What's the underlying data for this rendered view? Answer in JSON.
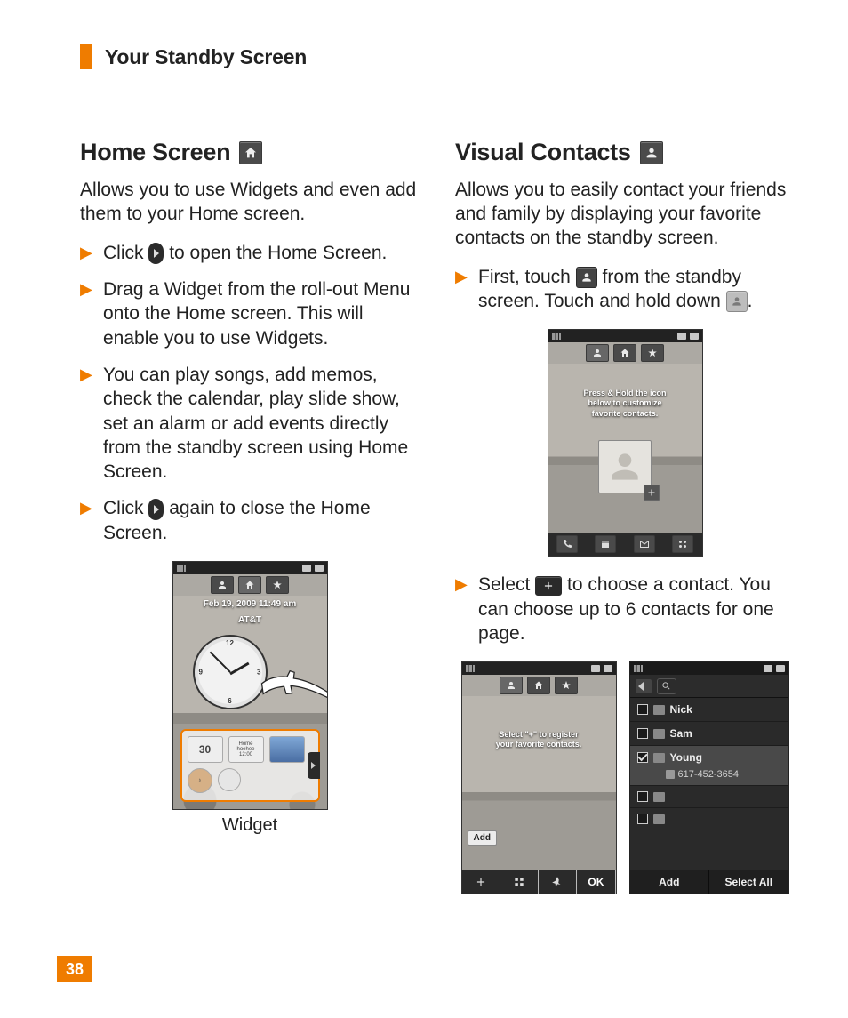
{
  "header": {
    "title": "Your Standby Screen"
  },
  "page_number": "38",
  "left": {
    "title": "Home Screen",
    "desc": "Allows you to use Widgets and even add them to your Home screen.",
    "steps": {
      "s1a": "Click ",
      "s1b": " to open the Home Screen.",
      "s2": "Drag a Widget from the roll-out Menu onto the Home screen. This will enable you to use Widgets.",
      "s3": "You can play songs, add memos, check the calendar, play slide show, set an alarm or add events directly from the standby screen using Home Screen.",
      "s4a": "Click ",
      "s4b": " again to close the Home Screen."
    },
    "phone": {
      "date": "Feb 19, 2009 11:49 am",
      "carrier": "AT&T",
      "cal_day": "30",
      "memo1": "Home",
      "memo2": "hoehee",
      "memo3": "12:00"
    },
    "widget_caption": "Widget"
  },
  "right": {
    "title": "Visual Contacts",
    "desc": "Allows you to easily contact your friends and family by displaying your favorite contacts on the standby screen.",
    "steps": {
      "s1a": "First, touch ",
      "s1b": " from the standby screen. Touch and hold down ",
      "s1c": ".",
      "s2a": "Select ",
      "s2b": " to choose a contact. You can choose up to 6 contacts for one page."
    },
    "phone1": {
      "overlay_l1": "Press & Hold the icon",
      "overlay_l2": "below to customize",
      "overlay_l3": "favorite contacts."
    },
    "phone2": {
      "overlay_l1": "Select \"+\" to register",
      "overlay_l2": "your favorite contacts.",
      "add_tag": "Add",
      "ok": "OK"
    },
    "contacts": {
      "c1": "Nick",
      "c2": "Sam",
      "c3": "Young",
      "c3_phone": "617-452-3654",
      "btn_add": "Add",
      "btn_select_all": "Select All"
    }
  }
}
